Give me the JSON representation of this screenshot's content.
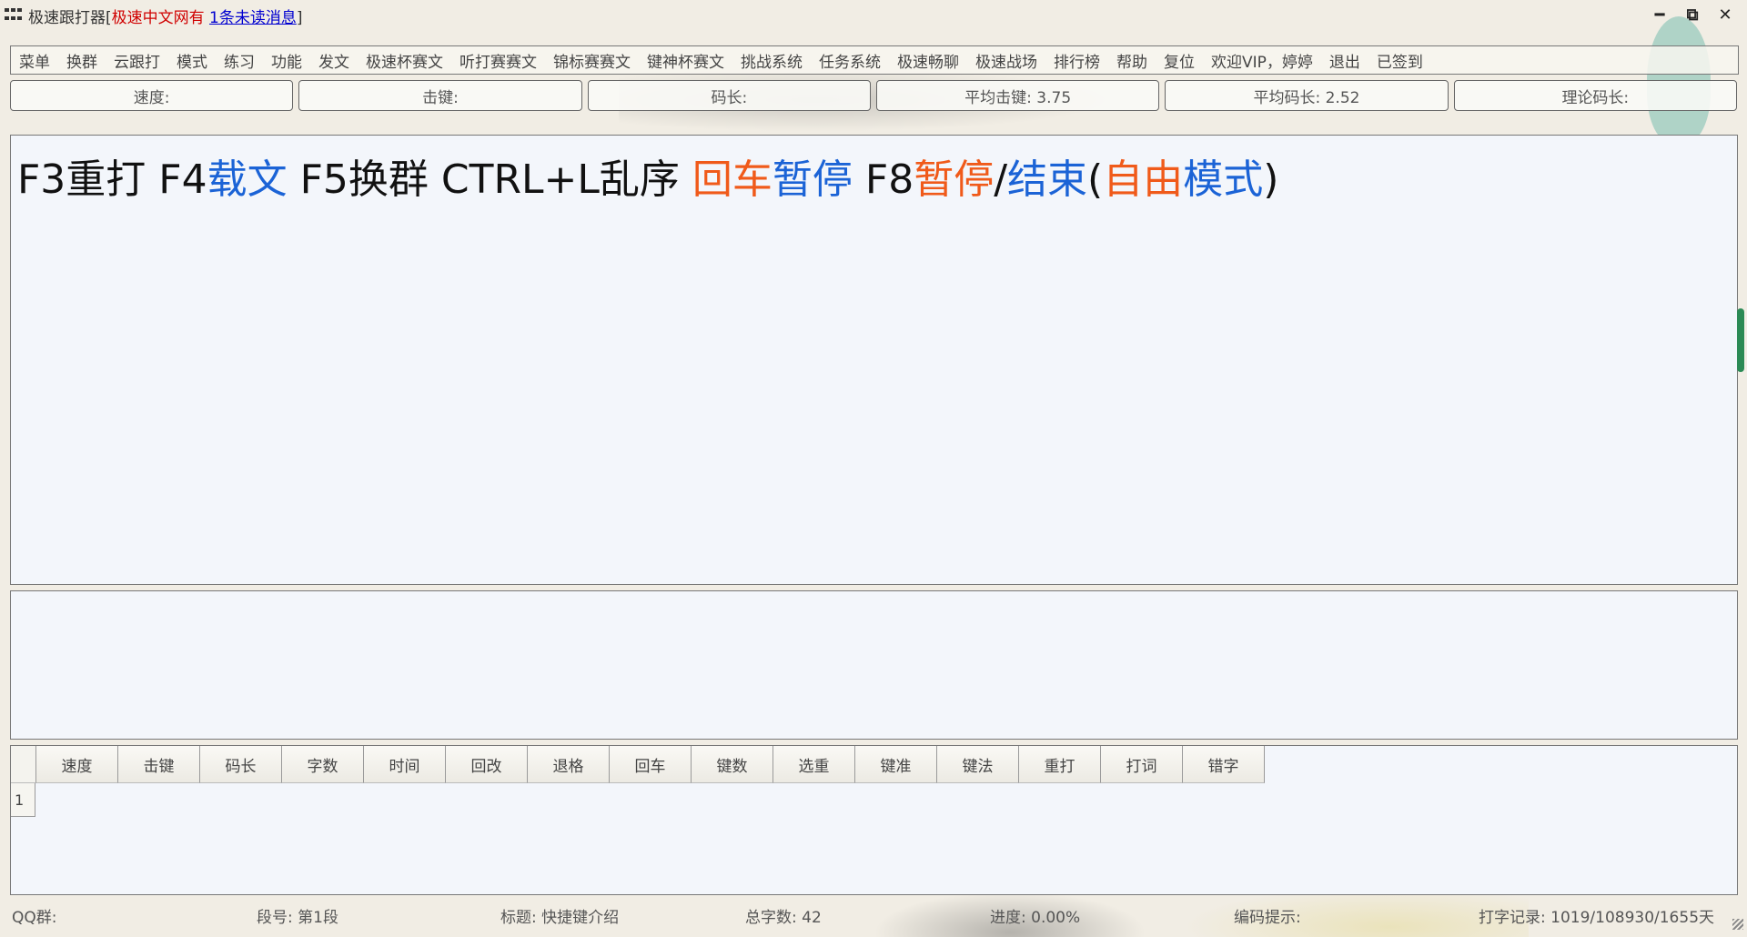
{
  "window": {
    "title": "极速跟打器[",
    "title_red": "极速中文网有",
    "title_space": " ",
    "title_link": "1条未读消息",
    "title_end": "]",
    "controls": {
      "minimize": "━",
      "restore": "⧉",
      "close": "✕"
    }
  },
  "menu": [
    "菜单",
    "换群",
    "云跟打",
    "模式",
    "练习",
    "功能",
    "发文",
    "极速杯赛文",
    "听打赛赛文",
    "锦标赛赛文",
    "键神杯赛文",
    "挑战系统",
    "任务系统",
    "极速畅聊",
    "极速战场",
    "排行榜",
    "帮助",
    "复位",
    "欢迎VIP，婷婷",
    "退出",
    "已签到"
  ],
  "stats": [
    "速度:",
    "击键:",
    "码长:",
    "平均击键: 3.75",
    "平均码长: 2.52",
    "理论码长:"
  ],
  "text_pane": {
    "segments": [
      {
        "text": "F3重打 F4",
        "color": "default"
      },
      {
        "text": "载文",
        "color": "blue"
      },
      {
        "text": " F5换群 CTRL+L乱序 ",
        "color": "default"
      },
      {
        "text": "回车",
        "color": "orange"
      },
      {
        "text": "暂停",
        "color": "blue"
      },
      {
        "text": " F8",
        "color": "default"
      },
      {
        "text": "暂停",
        "color": "orange"
      },
      {
        "text": "/",
        "color": "default"
      },
      {
        "text": "结束",
        "color": "blue"
      },
      {
        "text": "(",
        "color": "default"
      },
      {
        "text": "自由",
        "color": "orange"
      },
      {
        "text": "模式",
        "color": "blue"
      },
      {
        "text": ")",
        "color": "default"
      }
    ]
  },
  "table": {
    "headers": [
      "速度",
      "击键",
      "码长",
      "字数",
      "时间",
      "回改",
      "退格",
      "回车",
      "键数",
      "选重",
      "键准",
      "键法",
      "重打",
      "打词",
      "错字"
    ],
    "rows": [
      "1"
    ]
  },
  "status": {
    "qq": "QQ群:",
    "segment": "段号: 第1段",
    "title": "标题: 快捷键介绍",
    "total": "总字数: 42",
    "progress": "进度: 0.00%",
    "hint": "编码提示:",
    "record": "打字记录: 1019/108930/1655天"
  },
  "colors": {
    "orange": "#f05a1a",
    "blue": "#1b63d6",
    "title_red": "#d00000",
    "title_link": "#0000d0"
  }
}
